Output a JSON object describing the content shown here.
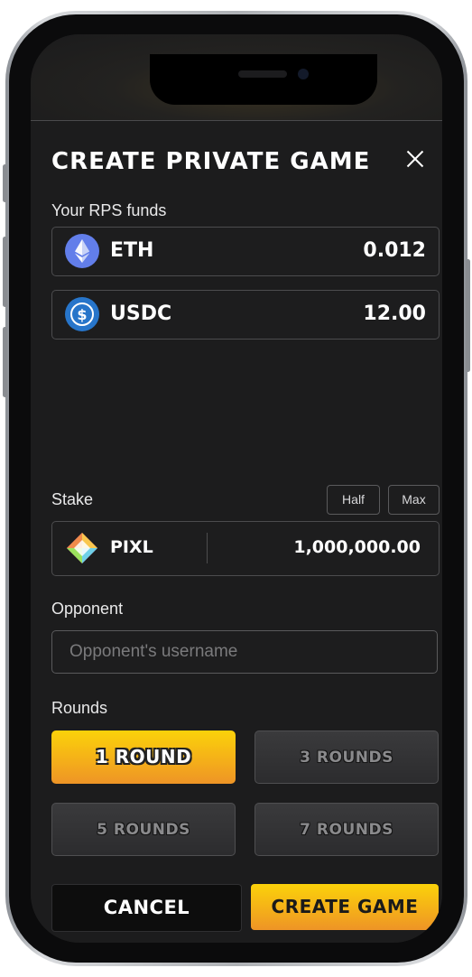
{
  "modal": {
    "title": "CREATE PRIVATE GAME",
    "funds_label": "Your RPS funds",
    "funds": [
      {
        "symbol": "ETH",
        "amount": "0.012",
        "icon": "ethereum-icon",
        "color": "#627EEA"
      },
      {
        "symbol": "USDC",
        "amount": "12.00",
        "icon": "usdc-icon",
        "color": "#2775CA"
      }
    ],
    "stake": {
      "label": "Stake",
      "half_label": "Half",
      "max_label": "Max",
      "token": "PIXL",
      "token_icon": "pixl-gem-icon",
      "amount": "1,000,000.00"
    },
    "opponent": {
      "label": "Opponent",
      "placeholder": "Opponent's username",
      "value": ""
    },
    "rounds": {
      "label": "Rounds",
      "options": [
        {
          "label": "1 ROUND",
          "selected": true
        },
        {
          "label": "3 ROUNDS",
          "selected": false
        },
        {
          "label": "5 ROUNDS",
          "selected": false
        },
        {
          "label": "7 ROUNDS",
          "selected": false
        }
      ]
    },
    "cancel_label": "CANCEL",
    "create_label": "CREATE GAME"
  },
  "colors": {
    "accent_yellow": "#FBD20A",
    "accent_orange": "#EE9426",
    "background": "#1C1C1D",
    "border": "#4C4C4E"
  }
}
